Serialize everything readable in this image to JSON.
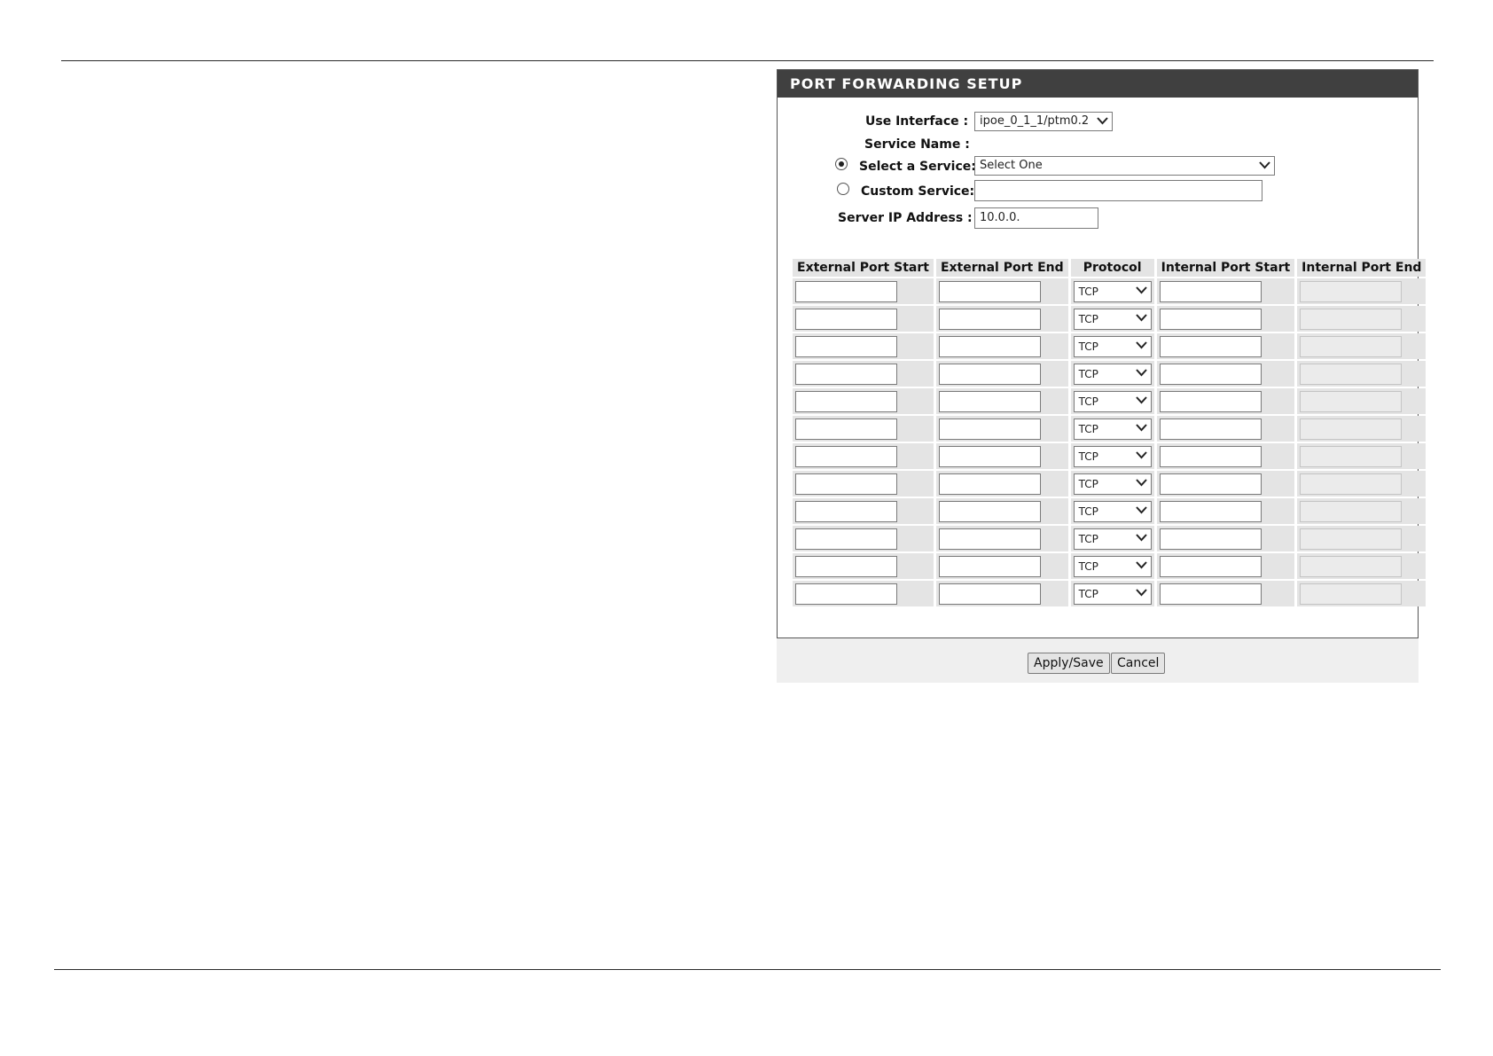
{
  "panel": {
    "title": "PORT FORWARDING SETUP"
  },
  "form": {
    "use_interface_label": "Use Interface :",
    "use_interface_value": "ipoe_0_1_1/ptm0.2",
    "service_name_label": "Service Name :",
    "select_service_label": "Select a Service:",
    "select_service_value": "Select One",
    "select_service_checked": true,
    "custom_service_label": "Custom Service:",
    "custom_service_value": "",
    "custom_service_checked": false,
    "server_ip_label": "Server IP Address :",
    "server_ip_value": "10.0.0."
  },
  "table": {
    "headers": [
      "External Port Start",
      "External Port End",
      "Protocol",
      "Internal Port Start",
      "Internal Port End"
    ],
    "rows": [
      {
        "protocol": "TCP"
      },
      {
        "protocol": "TCP"
      },
      {
        "protocol": "TCP"
      },
      {
        "protocol": "TCP"
      },
      {
        "protocol": "TCP"
      },
      {
        "protocol": "TCP"
      },
      {
        "protocol": "TCP"
      },
      {
        "protocol": "TCP"
      },
      {
        "protocol": "TCP"
      },
      {
        "protocol": "TCP"
      },
      {
        "protocol": "TCP"
      },
      {
        "protocol": "TCP"
      }
    ]
  },
  "buttons": {
    "apply": "Apply/Save",
    "cancel": "Cancel"
  }
}
